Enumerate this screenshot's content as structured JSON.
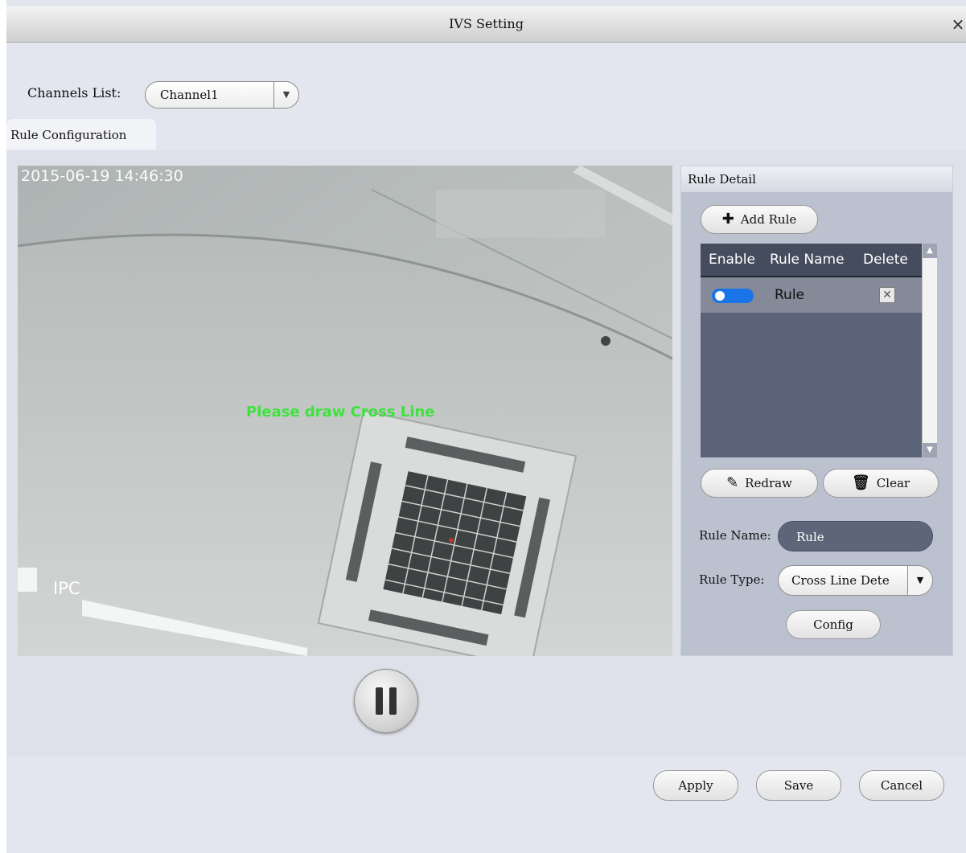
{
  "window": {
    "title": "IVS Setting",
    "close_glyph": "×"
  },
  "channels": {
    "label": "Channels List:",
    "selected": "Channel1"
  },
  "tab": {
    "label": "Rule Configuration"
  },
  "video": {
    "timestamp": "2015-06-19 14:46:30",
    "camera_label": "IPC",
    "prompt": "Please draw Cross Line"
  },
  "panel": {
    "title": "Rule Detail",
    "add_rule": "Add Rule",
    "table": {
      "headers": [
        "Enable",
        "Rule Name",
        "Delete"
      ],
      "rows": [
        {
          "enabled": true,
          "name": "Rule"
        }
      ]
    },
    "redraw": "Redraw",
    "clear": "Clear",
    "rule_name_label": "Rule Name:",
    "rule_name_value": "Rule",
    "rule_type_label": "Rule Type:",
    "rule_type_value": "Cross Line Dete",
    "config": "Config"
  },
  "footer": {
    "apply": "Apply",
    "save": "Save",
    "cancel": "Cancel"
  },
  "colors": {
    "prompt_green": "#3de33d",
    "toggle_on": "#1a74e8",
    "table_bg": "#5a6377"
  }
}
